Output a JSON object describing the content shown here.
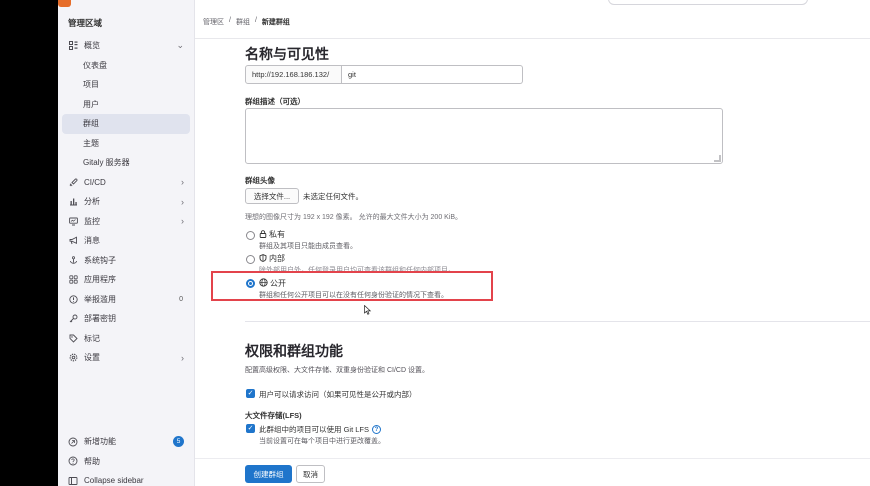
{
  "sidebar": {
    "title": "管理区域",
    "items": [
      {
        "label": "概览",
        "icon": "overview-icon",
        "chev": "⌄"
      },
      {
        "label": "仪表盘",
        "sub": true
      },
      {
        "label": "项目",
        "sub": true
      },
      {
        "label": "用户",
        "sub": true
      },
      {
        "label": "群组",
        "sub": true,
        "active": true
      },
      {
        "label": "主题",
        "sub": true
      },
      {
        "label": "Gitaly 服务器",
        "sub": true
      },
      {
        "label": "CI/CD",
        "icon": "rocket-icon",
        "chev": "›"
      },
      {
        "label": "分析",
        "icon": "chart-icon",
        "chev": "›"
      },
      {
        "label": "监控",
        "icon": "monitor-icon",
        "chev": "›"
      },
      {
        "label": "消息",
        "icon": "bullhorn-icon"
      },
      {
        "label": "系统钩子",
        "icon": "hook-icon"
      },
      {
        "label": "应用程序",
        "icon": "apps-icon"
      },
      {
        "label": "举报滥用",
        "icon": "abuse-icon",
        "count": "0"
      },
      {
        "label": "部署密钥",
        "icon": "key-icon"
      },
      {
        "label": "标记",
        "icon": "label-icon"
      },
      {
        "label": "设置",
        "icon": "gear-icon",
        "chev": "›"
      }
    ],
    "bottom": [
      {
        "label": "新增功能",
        "icon": "whats-new-icon",
        "badge": "5"
      },
      {
        "label": "帮助",
        "icon": "help-icon"
      },
      {
        "label": "Collapse sidebar",
        "icon": "collapse-icon"
      }
    ]
  },
  "breadcrumb": [
    "管理区",
    "群组",
    "新建群组"
  ],
  "breadcrumb_sep": "/",
  "section1": {
    "title": "名称与可见性",
    "url_prefix": "http://192.168.186.132/",
    "url_value": "git",
    "desc_label": "群组描述（可选）",
    "avatar_label": "群组头像",
    "file_button": "选择文件...",
    "file_status": "未选定任何文件。",
    "avatar_help": "理想的图像尺寸为 192 x 192 像素。 允许的最大文件大小为 200 KiB。",
    "visibility": [
      {
        "label": "私有",
        "icon": "lock-icon",
        "desc": "群组及其项目只能由成员查看。",
        "checked": false
      },
      {
        "label": "内部",
        "icon": "shield-icon",
        "desc": "除外部用户外，任何登录用户均可查看该群组和任何内部项目。",
        "checked": false
      },
      {
        "label": "公开",
        "icon": "globe-icon",
        "desc": "群组和任何公开项目可以在没有任何身份验证的情况下查看。",
        "checked": true
      }
    ]
  },
  "section2": {
    "title": "权限和群组功能",
    "desc": "配置高级权限、大文件存储、双重身份验证和 CI/CD 设置。",
    "request_access": "用户可以请求访问（如果可见性是公开或内部）",
    "lfs_title": "大文件存储(LFS)",
    "lfs_checkbox": "此群组中的项目可以使用 Git LFS",
    "lfs_help": "当前设置可在每个项目中进行更改覆盖。"
  },
  "buttons": {
    "create": "创建群组",
    "cancel": "取消"
  },
  "colors": {
    "primary": "#1f75cb",
    "highlight": "#e3434b"
  }
}
